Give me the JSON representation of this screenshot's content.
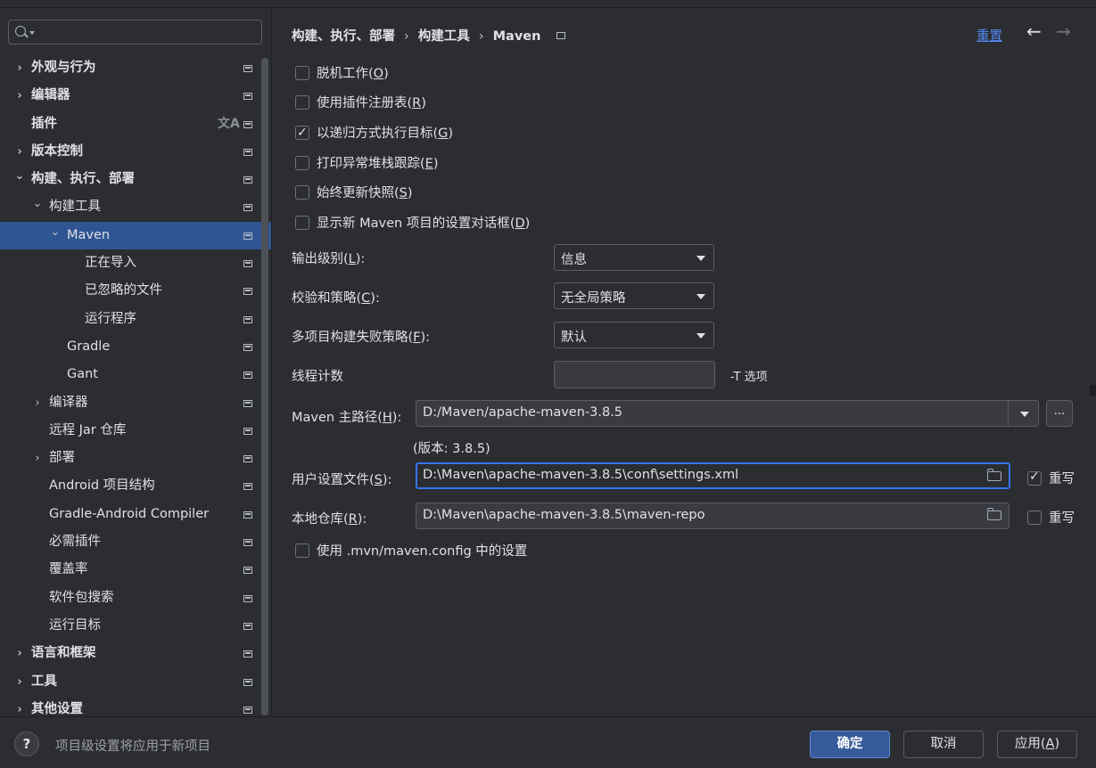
{
  "sidebar": {
    "items": [
      {
        "label": "外观与行为",
        "level": 0,
        "arrow": "›",
        "bold": true
      },
      {
        "label": "编辑器",
        "level": 0,
        "arrow": "›",
        "bold": true
      },
      {
        "label": "插件",
        "level": 0,
        "arrow": "",
        "bold": true,
        "translate": true
      },
      {
        "label": "版本控制",
        "level": 0,
        "arrow": "›",
        "bold": true
      },
      {
        "label": "构建、执行、部署",
        "level": 0,
        "arrow": "⌄",
        "bold": true
      },
      {
        "label": "构建工具",
        "level": 1,
        "arrow": "⌄"
      },
      {
        "label": "Maven",
        "level": 2,
        "arrow": "⌄",
        "selected": true
      },
      {
        "label": "正在导入",
        "level": 3,
        "arrow": ""
      },
      {
        "label": "已忽略的文件",
        "level": 3,
        "arrow": ""
      },
      {
        "label": "运行程序",
        "level": 3,
        "arrow": ""
      },
      {
        "label": "Gradle",
        "level": 2,
        "arrow": ""
      },
      {
        "label": "Gant",
        "level": 2,
        "arrow": ""
      },
      {
        "label": "编译器",
        "level": 1,
        "arrow": "›"
      },
      {
        "label": "远程 Jar 仓库",
        "level": 1,
        "arrow": ""
      },
      {
        "label": "部署",
        "level": 1,
        "arrow": "›"
      },
      {
        "label": "Android 项目结构",
        "level": 1,
        "arrow": ""
      },
      {
        "label": "Gradle-Android Compiler",
        "level": 1,
        "arrow": ""
      },
      {
        "label": "必需插件",
        "level": 1,
        "arrow": ""
      },
      {
        "label": "覆盖率",
        "level": 1,
        "arrow": ""
      },
      {
        "label": "软件包搜索",
        "level": 1,
        "arrow": ""
      },
      {
        "label": "运行目标",
        "level": 1,
        "arrow": ""
      },
      {
        "label": "语言和框架",
        "level": 0,
        "arrow": "›",
        "bold": true
      },
      {
        "label": "工具",
        "level": 0,
        "arrow": "›",
        "bold": true
      },
      {
        "label": "其他设置",
        "level": 0,
        "arrow": "›",
        "bold": true
      }
    ],
    "translate_glyph": "文A"
  },
  "header": {
    "crumb1": "构建、执行、部署",
    "crumb2": "构建工具",
    "crumb3": "Maven",
    "separator": "›",
    "reset": "重置",
    "back": "←",
    "forward": "→"
  },
  "options": {
    "offline": {
      "label": "脱机工作",
      "key": "O",
      "checked": false
    },
    "plugin_registry": {
      "label": "使用插件注册表",
      "key": "R",
      "checked": false
    },
    "recursive": {
      "label": "以递归方式执行目标",
      "key": "G",
      "checked": true
    },
    "stacktrace": {
      "label": "打印异常堆栈跟踪",
      "key": "E",
      "checked": false
    },
    "update_snapshots": {
      "label": "始终更新快照",
      "key": "S",
      "checked": false
    },
    "show_dialog": {
      "label": "显示新 Maven 项目的设置对话框",
      "key": "D",
      "checked": false
    }
  },
  "fields": {
    "output_level": {
      "label": "输出级别",
      "key": "L",
      "value": "信息"
    },
    "checksum": {
      "label": "校验和策略",
      "key": "C",
      "value": "无全局策略"
    },
    "failure": {
      "label": "多项目构建失败策略",
      "key": "F",
      "value": "默认"
    },
    "threads": {
      "label": "线程计数",
      "value": "",
      "hint": "-T 选项"
    },
    "maven_home": {
      "label": "Maven 主路径",
      "key": "H",
      "value": "D:/Maven/apache-maven-3.8.5",
      "browse": "...",
      "version": "(版本: 3.8.5)"
    },
    "user_settings": {
      "label": "用户设置文件",
      "key": "S",
      "value": "D:\\Maven\\apache-maven-3.8.5\\conf\\settings.xml",
      "override_label": "重写",
      "override_checked": true
    },
    "local_repo": {
      "label": "本地仓库",
      "key": "R",
      "value": "D:\\Maven\\apache-maven-3.8.5\\maven-repo",
      "override_label": "重写",
      "override_checked": false
    },
    "mvn_config": {
      "label": "使用 .mvn/maven.config 中的设置",
      "checked": false
    }
  },
  "footer": {
    "help": "?",
    "note": "项目级设置将应用于新项目",
    "ok": "确定",
    "cancel": "取消",
    "apply_label": "应用",
    "apply_key": "A"
  },
  "colors": {
    "background": "#2b2d30",
    "selection": "#2f5593",
    "link": "#548af7",
    "focus": "#3574f0",
    "text": "#dfe1e5"
  }
}
